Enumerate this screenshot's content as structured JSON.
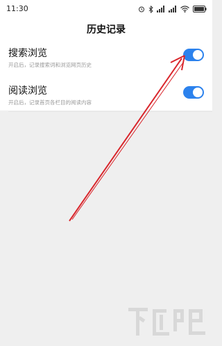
{
  "status_bar": {
    "time": "11:30",
    "icons": [
      "alarm-icon",
      "bluetooth-icon",
      "signal-icon",
      "signal-icon",
      "wifi-icon",
      "battery-icon"
    ]
  },
  "header": {
    "title": "历史记录"
  },
  "settings": [
    {
      "title": "搜索浏览",
      "description": "开启后，记录搜索词和浏览网页历史",
      "enabled": true
    },
    {
      "title": "阅读浏览",
      "description": "开启后，记录首页各栏目的阅读内容",
      "enabled": true
    }
  ],
  "colors": {
    "toggle_on": "#2c82ed",
    "annotation_arrow": "#d9262c",
    "background": "#efefef"
  },
  "watermark": {
    "logo_text": "下载吧"
  }
}
